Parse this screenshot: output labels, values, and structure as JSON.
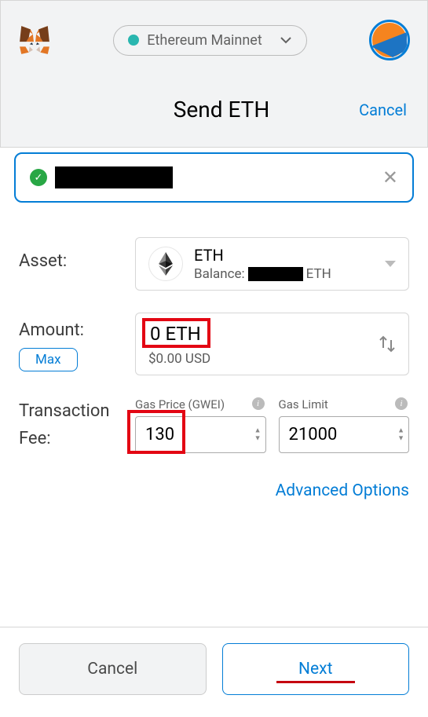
{
  "header": {
    "network_label": "Ethereum Mainnet",
    "title": "Send ETH",
    "cancel_label": "Cancel"
  },
  "asset": {
    "row_label": "Asset:",
    "symbol": "ETH",
    "balance_label": "Balance:",
    "balance_suffix": "ETH"
  },
  "amount": {
    "row_label": "Amount:",
    "value": "0 ETH",
    "usd": "$0.00 USD",
    "max_label": "Max"
  },
  "tx": {
    "row_label": "Transaction Fee:",
    "gas_price_label": "Gas Price (GWEI)",
    "gas_price_value": "130",
    "gas_limit_label": "Gas Limit",
    "gas_limit_value": "21000",
    "advanced_label": "Advanced Options"
  },
  "footer": {
    "cancel_label": "Cancel",
    "next_label": "Next"
  }
}
